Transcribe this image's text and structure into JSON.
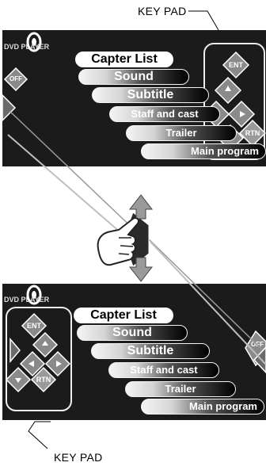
{
  "brand": {
    "logo_text": "DVD PLAYER"
  },
  "menu": {
    "items": [
      "Capter List",
      "Sound",
      "Subtitle",
      "Staff and cast",
      "Trailer",
      "Main program"
    ]
  },
  "keys": {
    "off": "OFF",
    "enter": "ENT",
    "return": "RTN"
  },
  "callouts": {
    "top": "KEY PAD",
    "bottom": "KEY PAD"
  },
  "colors": {
    "screen_background": "#1b1b1b",
    "key_fill": "#8a8a8a",
    "rtn_fill": "#9a9a9a"
  }
}
